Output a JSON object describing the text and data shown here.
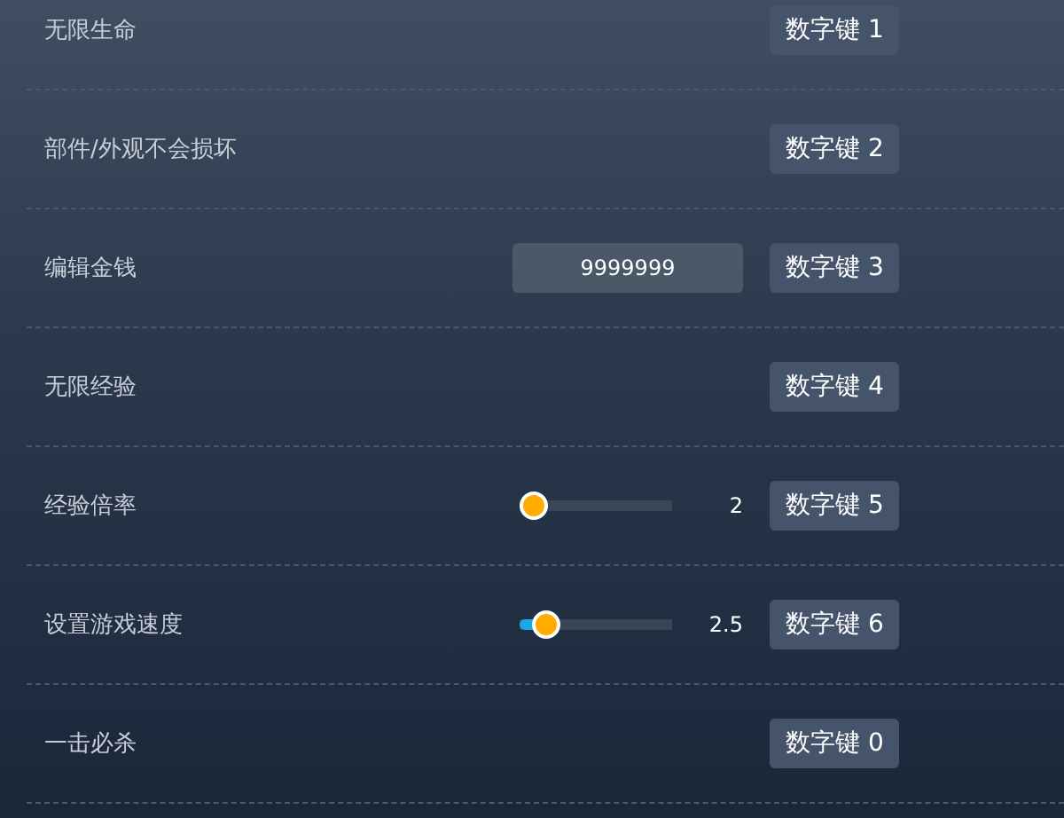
{
  "rows": [
    {
      "kind": "toggle",
      "label": "无限生命",
      "hotkey": "数字键 1"
    },
    {
      "kind": "toggle",
      "label": "部件/外观不会损坏",
      "hotkey": "数字键 2"
    },
    {
      "kind": "input",
      "label": "编辑金钱",
      "value": "9999999",
      "hotkey": "数字键 3"
    },
    {
      "kind": "toggle",
      "label": "无限经验",
      "hotkey": "数字键 4"
    },
    {
      "kind": "slider",
      "label": "经验倍率",
      "level": 0,
      "reading": "2",
      "hotkey": "数字键 5"
    },
    {
      "kind": "slider",
      "label": "设置游戏速度",
      "level": 0.1,
      "reading": "2.5",
      "hotkey": "数字键 6"
    },
    {
      "kind": "toggle",
      "label": "一击必杀",
      "hotkey": "数字键 0"
    }
  ]
}
